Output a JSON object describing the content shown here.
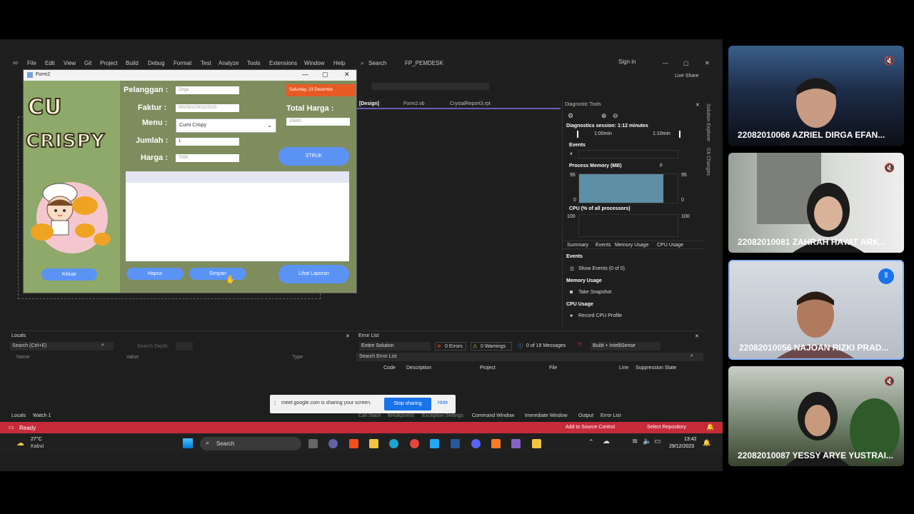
{
  "ide": {
    "menu": [
      "File",
      "Edit",
      "View",
      "Git",
      "Project",
      "Build",
      "Debug",
      "Format",
      "Test",
      "Analyze",
      "Tools",
      "Extensions",
      "Window",
      "Help"
    ],
    "search_label": "Search",
    "solution_name": "FP_PEMDESK",
    "sign_in": "Sign in",
    "live_share": "Live Share",
    "tabs": [
      "[Design]",
      "Form2.vb",
      "CrystalReport3.rpt"
    ],
    "side_tabs": [
      "Solution Explorer",
      "Git Changes"
    ]
  },
  "form2": {
    "title": "Form2",
    "logo_line1": "CU",
    "logo_line2": "CRISPY",
    "labels": {
      "pelanggan": "Pelanggan :",
      "faktur": "Faktur :",
      "menu": "Menu :",
      "jumlah": "Jumlah :",
      "harga": "Harga :",
      "total": "Total Harga :"
    },
    "values": {
      "pelanggan": "Dirga",
      "faktur": "INV/001/29/12/2023",
      "menu": "Cumi Crispy",
      "jumlah": "1",
      "harga": "7000",
      "total": "15500"
    },
    "date": "Saturday, 23 Decembe",
    "buttons": {
      "struk": "STRUK",
      "keluar": "Keluar",
      "hapus": "Hapus",
      "simpan": "Simpan",
      "lihat": "Lihat Laporan"
    }
  },
  "diagnostic": {
    "title": "Diagnostic Tools",
    "session": "Diagnostics session: 1:12 minutes",
    "ticks": [
      "1:00min",
      "1:10min"
    ],
    "events_label": "Events",
    "memory_label": "Process Memory (MB)",
    "memory_legend": "F",
    "memory_max": "95",
    "memory_min": "0",
    "cpu_label": "CPU (% of all processors)",
    "cpu_max": "100",
    "tabs": [
      "Summary",
      "Events",
      "Memory Usage",
      "CPU Usage"
    ],
    "sections": {
      "events": "Events",
      "show_events": "Show Events (0 of 0)",
      "memory": "Memory Usage",
      "take_snapshot": "Take Snapshot",
      "cpu": "CPU Usage",
      "record_cpu": "Record CPU Profile"
    }
  },
  "locals": {
    "title": "Locals",
    "search_placeholder": "Search (Ctrl+E)",
    "search_depth": "Search Depth:",
    "columns": [
      "Name",
      "Value",
      "Type"
    ],
    "bottom_tabs": [
      "Locals",
      "Watch 1"
    ]
  },
  "error_list": {
    "title": "Error List",
    "scope": "Entire Solution",
    "errors": "0 Errors",
    "warnings": "0 Warnings",
    "messages": "0 of 19 Messages",
    "build": "Build + IntelliSense",
    "search_placeholder": "Search Error List",
    "columns": [
      "Code",
      "Description",
      "Project",
      "File",
      "Line",
      "Suppression State"
    ],
    "bottom_tabs": [
      "Call Stack",
      "Breakpoints",
      "Exception Settings",
      "Command Window",
      "Immediate Window",
      "Output",
      "Error List"
    ]
  },
  "sharing": {
    "text": "meet.google.com is sharing your screen.",
    "stop": "Stop sharing",
    "hide": "Hide"
  },
  "status": {
    "ready": "Ready",
    "add_source": "Add to Source Control",
    "select_repo": "Select Repository"
  },
  "taskbar": {
    "weather_temp": "27°C",
    "weather_desc": "Kabut",
    "search": "Search",
    "time": "13:42",
    "date": "29/12/2023"
  },
  "participants": [
    {
      "name": "22082010066 AZRIEL DIRGA EFAN..."
    },
    {
      "name": "22082010081 ZAHRAH HAYAT ARK..."
    },
    {
      "name": "22082010056 NAJOAN RIZKI PRAD..."
    },
    {
      "name": "22082010087 YESSY ARYE YUSTRAI..."
    }
  ]
}
